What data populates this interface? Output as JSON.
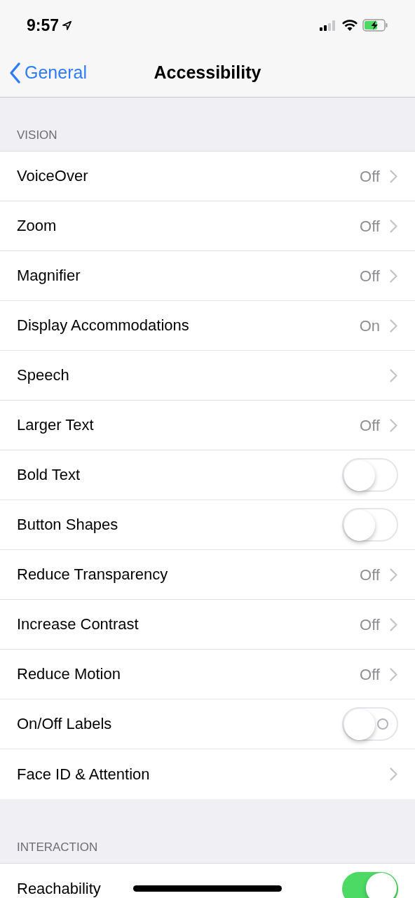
{
  "status_bar": {
    "time": "9:57",
    "location": true
  },
  "nav": {
    "back": "General",
    "title": "Accessibility"
  },
  "sections": [
    {
      "header": "VISION",
      "rows": [
        {
          "kind": "disclosure",
          "label": "VoiceOver",
          "value": "Off"
        },
        {
          "kind": "disclosure",
          "label": "Zoom",
          "value": "Off"
        },
        {
          "kind": "disclosure",
          "label": "Magnifier",
          "value": "Off"
        },
        {
          "kind": "disclosure",
          "label": "Display Accommodations",
          "value": "On"
        },
        {
          "kind": "disclosure",
          "label": "Speech"
        },
        {
          "kind": "disclosure",
          "label": "Larger Text",
          "value": "Off"
        },
        {
          "kind": "toggle",
          "label": "Bold Text",
          "on": false,
          "show_label": false
        },
        {
          "kind": "toggle",
          "label": "Button Shapes",
          "on": false,
          "show_label": false
        },
        {
          "kind": "disclosure",
          "label": "Reduce Transparency",
          "value": "Off"
        },
        {
          "kind": "disclosure",
          "label": "Increase Contrast",
          "value": "Off"
        },
        {
          "kind": "disclosure",
          "label": "Reduce Motion",
          "value": "Off"
        },
        {
          "kind": "toggle",
          "label": "On/Off Labels",
          "on": false,
          "show_label": true
        },
        {
          "kind": "disclosure",
          "label": "Face ID & Attention"
        }
      ]
    },
    {
      "header": "INTERACTION",
      "rows": [
        {
          "kind": "toggle",
          "label": "Reachability",
          "on": true,
          "show_label": false
        }
      ]
    }
  ]
}
